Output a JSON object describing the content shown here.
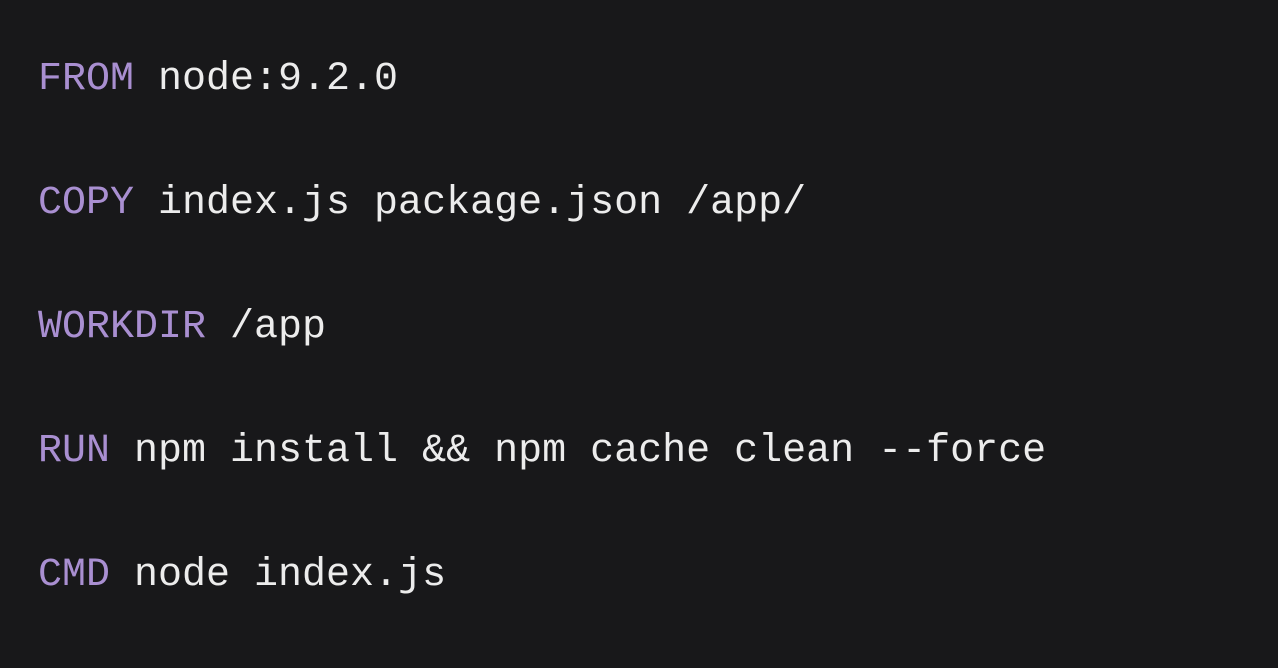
{
  "colors": {
    "background": "#18181a",
    "keyword": "#a98fd1",
    "text": "#ececec"
  },
  "code": {
    "language": "Dockerfile",
    "lines": [
      {
        "keyword": "FROM",
        "args": " node:9.2.0"
      },
      {
        "keyword": "COPY",
        "args": " index.js package.json /app/"
      },
      {
        "keyword": "WORKDIR",
        "args": " /app"
      },
      {
        "keyword": "RUN",
        "args": " npm install && npm cache clean --force"
      },
      {
        "keyword": "CMD",
        "args": " node index.js"
      }
    ]
  }
}
